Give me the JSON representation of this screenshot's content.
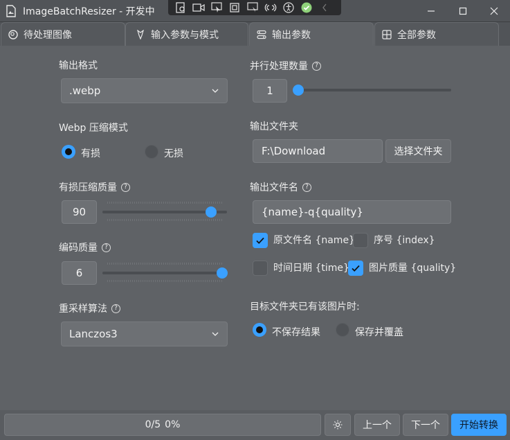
{
  "window": {
    "title": "ImageBatchResizer - 开发中"
  },
  "tabs": [
    {
      "label": "待处理图像",
      "icon": "images-icon"
    },
    {
      "label": "输入参数与模式",
      "icon": "pen-icon"
    },
    {
      "label": "输出参数",
      "icon": "settings-icon"
    },
    {
      "label": "全部参数",
      "icon": "grid-icon"
    }
  ],
  "left": {
    "output_format_label": "输出格式",
    "output_format_value": ".webp",
    "webp_mode_label": "Webp 压缩模式",
    "radio_lossy": "有损",
    "radio_lossless": "无损",
    "lossy_quality_label": "有损压缩质量",
    "lossy_quality_value": "90",
    "lossy_quality_level": 0.9,
    "encode_quality_label": "编码质量",
    "encode_quality_value": "6",
    "encode_quality_level": 1.0,
    "resample_label": "重采样算法",
    "resample_value": "Lanczos3"
  },
  "right": {
    "parallel_label": "并行处理数量",
    "parallel_value": "1",
    "parallel_level": 0.0,
    "out_folder_label": "输出文件夹",
    "out_folder_value": "F:\\Download",
    "choose_folder_btn": "选择文件夹",
    "out_name_label": "输出文件名",
    "out_name_value": "{name}-q{quality}",
    "chk_name": "原文件名 {name}",
    "chk_index": "序号 {index}",
    "chk_time": "时间日期 {time}",
    "chk_quality": "图片质量 {quality}",
    "exists_label": "目标文件夹已有该图片时:",
    "radio_no_save": "不保存结果",
    "radio_overwrite": "保存并覆盖"
  },
  "bottom": {
    "progress_count": "0/5",
    "progress_pct": "0%",
    "prev_btn": "上一个",
    "next_btn": "下一个",
    "start_btn": "开始转换"
  },
  "colors": {
    "accent": "#3aa0ff",
    "background": "#5f6266"
  }
}
